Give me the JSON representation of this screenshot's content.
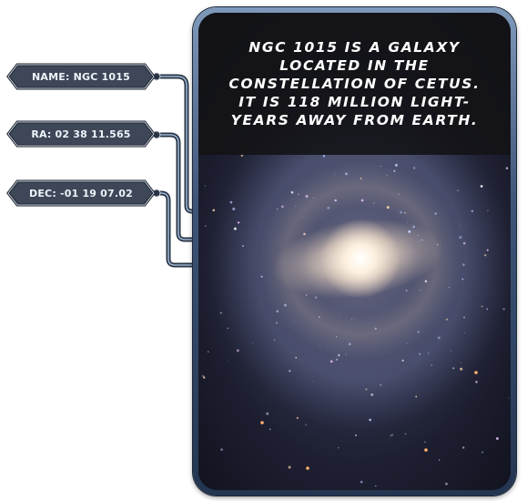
{
  "labels": {
    "name": "NAME: NGC 1015",
    "ra": "RA: 02 38 11.565",
    "dec": "DEC: -01 19 07.02"
  },
  "description": "NGC 1015 is a galaxy located in the constellation of Cetus. It is 118 million light-years away from Earth.",
  "image": {
    "subject": "barred spiral galaxy NGC 1015"
  },
  "colors": {
    "frame_light": "#7f99bb",
    "frame_dark": "#233550",
    "tag_fill": "#3d4757",
    "tag_border": "#c7d0dc",
    "caption_bg": "#121216",
    "text": "#ffffff"
  }
}
